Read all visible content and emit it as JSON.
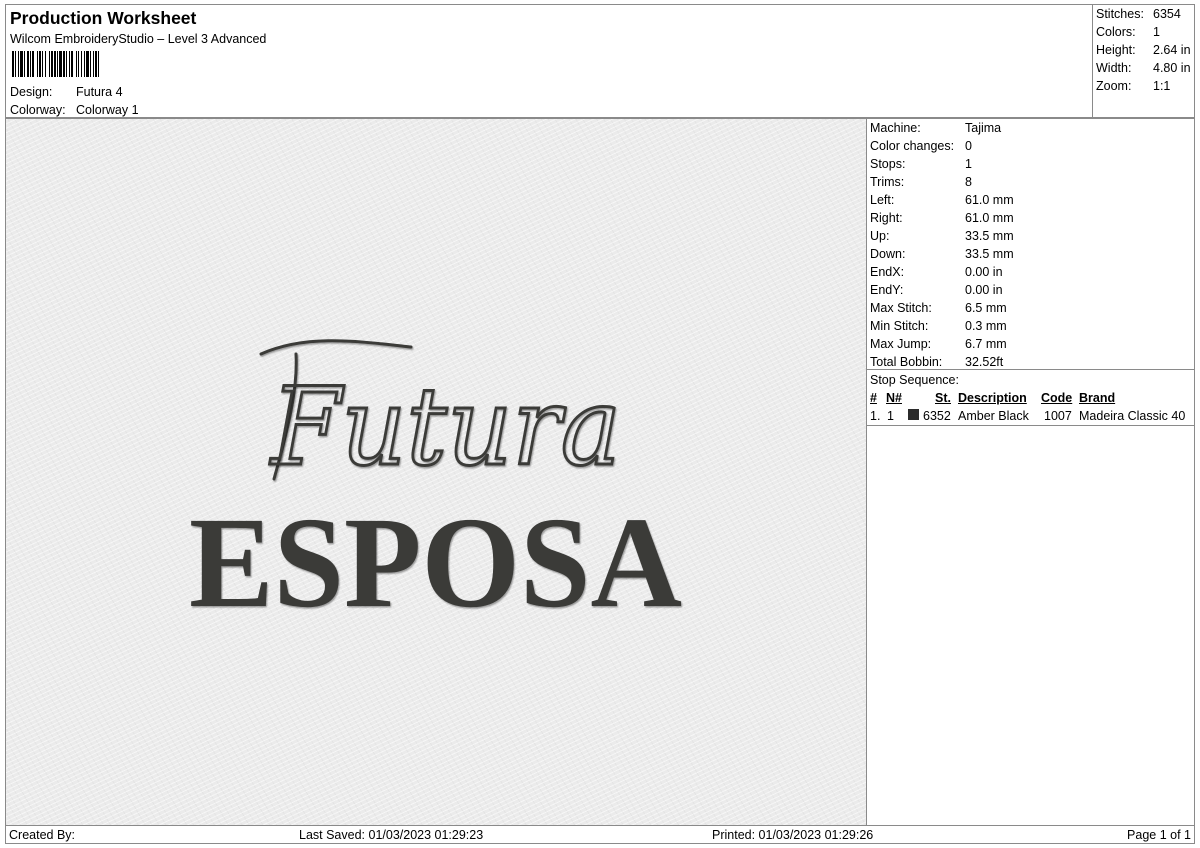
{
  "header": {
    "title": "Production Worksheet",
    "subtitle": "Wilcom EmbroideryStudio – Level 3 Advanced",
    "design_label": "Design:",
    "design_value": "Futura 4",
    "colorway_label": "Colorway:",
    "colorway_value": "Colorway 1"
  },
  "summary": {
    "stitches_label": "Stitches:",
    "stitches": "6354",
    "colors_label": "Colors:",
    "colors": "1",
    "height_label": "Height:",
    "height": "2.64 in",
    "width_label": "Width:",
    "width": "4.80 in",
    "zoom_label": "Zoom:",
    "zoom": "1:1"
  },
  "design": {
    "script_text": "Futura",
    "serif_text": "ESPOSA",
    "thread_color": "#3b3b39"
  },
  "details": [
    {
      "label": "Machine:",
      "value": "Tajima"
    },
    {
      "label": "Color changes:",
      "value": "0"
    },
    {
      "label": "Stops:",
      "value": "1"
    },
    {
      "label": "Trims:",
      "value": "8"
    },
    {
      "label": "Left:",
      "value": "61.0 mm"
    },
    {
      "label": "Right:",
      "value": "61.0 mm"
    },
    {
      "label": "Up:",
      "value": "33.5 mm"
    },
    {
      "label": "Down:",
      "value": "33.5 mm"
    },
    {
      "label": "EndX:",
      "value": "0.00 in"
    },
    {
      "label": "EndY:",
      "value": "0.00 in"
    },
    {
      "label": "Max Stitch:",
      "value": "6.5 mm"
    },
    {
      "label": "Min Stitch:",
      "value": "0.3 mm"
    },
    {
      "label": "Max Jump:",
      "value": "6.7 mm"
    },
    {
      "label": "Total Bobbin:",
      "value": "32.52ft"
    }
  ],
  "stops": {
    "label": "Stop Sequence:",
    "headers": {
      "num": "#",
      "n": "N#",
      "st": "St.",
      "description": "Description",
      "code": "Code",
      "brand": "Brand"
    },
    "rows": [
      {
        "num": "1.",
        "n": "1",
        "swatch": "#2b2b2b",
        "st": "6352",
        "description": "Amber Black",
        "code": "1007",
        "brand": "Madeira Classic 40"
      }
    ]
  },
  "footer": {
    "created_by": "Created By:",
    "last_saved": "Last Saved: 01/03/2023 01:29:23",
    "printed": "Printed: 01/03/2023 01:29:26",
    "page": "Page 1 of 1"
  }
}
